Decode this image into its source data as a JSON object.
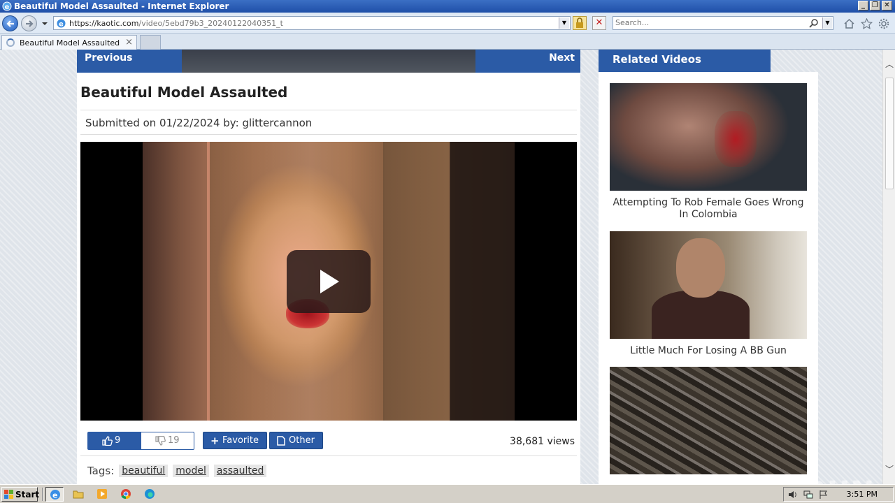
{
  "window": {
    "title": "Beautiful Model Assaulted - Internet Explorer",
    "controls": [
      "_",
      "❐",
      "✕"
    ]
  },
  "addressbar": {
    "url_host": "https://kaotic.com",
    "url_path": "/video/5ebd79b3_20240122040351_t",
    "search_placeholder": "Search..."
  },
  "tabs": [
    {
      "label": "Beautiful Model Assaulted",
      "close": "×",
      "loading": true
    }
  ],
  "pager": {
    "previous_label": "Previous",
    "next_label": "Next"
  },
  "video": {
    "title": "Beautiful Model Assaulted",
    "submitted_prefix": "Submitted on 01/22/2024 by:",
    "submitter": "glittercannon",
    "likes": "9",
    "dislikes": "19",
    "favorite_label": "Favorite",
    "favorite_icon": "+",
    "other_label": "Other",
    "views": "38,681 views",
    "tags_label": "Tags:",
    "tags": [
      "beautiful",
      "model",
      "assaulted"
    ]
  },
  "sidebar": {
    "heading": "Related Videos",
    "items": [
      {
        "caption": "Attempting To Rob Female Goes Wrong In Colombia"
      },
      {
        "caption": "Little Much For Losing A BB Gun"
      },
      {
        "caption": ""
      }
    ]
  },
  "watermark": "ANY RUN",
  "taskbar": {
    "start_label": "Start",
    "clock": "3:51 PM"
  },
  "colors": {
    "accent": "#2b5ba6",
    "title_bar": "#1f4fa8"
  }
}
